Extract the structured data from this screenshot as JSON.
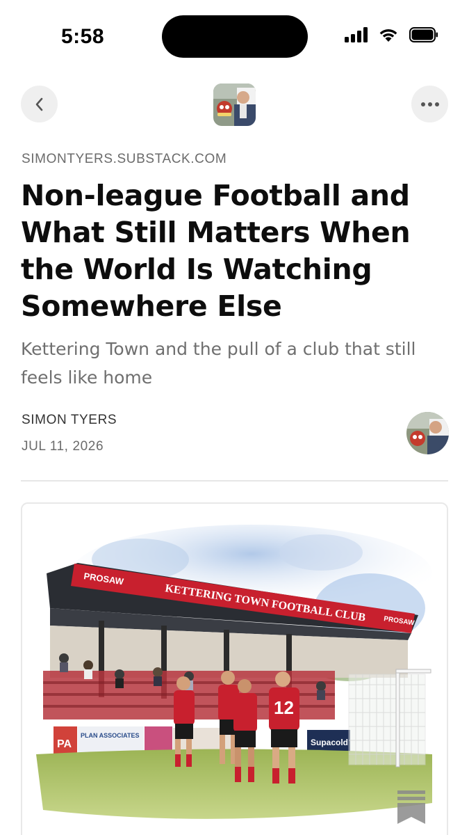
{
  "status_bar": {
    "time": "5:58"
  },
  "nav": {
    "back_icon": "chevron-left-icon",
    "more_icon": "more-horizontal-icon",
    "logo_alt": "publication-logo"
  },
  "article": {
    "domain": "SIMONTYERS.SUBSTACK.COM",
    "title": "Non-league Football and What Still Matters When the World Is Watching Somewhere Else",
    "subtitle": "Kettering Town and the pull of a club that still feels like home",
    "author": "SIMON TYERS",
    "date": "JUL 11, 2026"
  },
  "hero_image": {
    "stand_sign": "KETTERING TOWN FOOTBALL CLUB",
    "sponsor_left": "PROSAW",
    "sponsor_right": "PROSAW",
    "board_1": "PA",
    "board_2": "PLAN ASSOCIATES",
    "board_3": "Supacold",
    "player_number": "12"
  },
  "colors": {
    "club_red": "#c8202e",
    "text_primary": "#0d0d0d",
    "text_secondary": "#6f6f6f",
    "button_bg": "#efefef"
  }
}
